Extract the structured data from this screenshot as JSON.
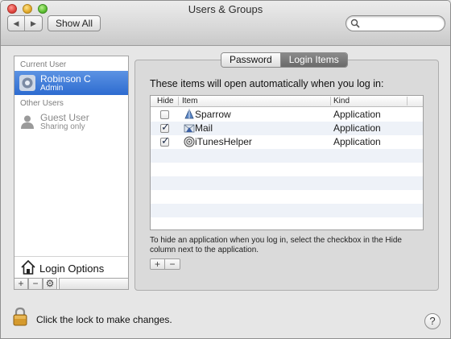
{
  "window": {
    "title": "Users & Groups"
  },
  "toolbar": {
    "back_icon": "◀",
    "forward_icon": "▶",
    "show_all_label": "Show All",
    "search_placeholder": ""
  },
  "sidebar": {
    "current_user_label": "Current User",
    "current_user": {
      "name": "Robinson C",
      "role": "Admin"
    },
    "other_users_label": "Other Users",
    "guest_user": {
      "name": "Guest User",
      "status": "Sharing only"
    },
    "login_options_label": "Login Options",
    "add_label": "+",
    "remove_label": "−",
    "gear_label": "⚙"
  },
  "tabs": [
    {
      "label": "Password",
      "active": false
    },
    {
      "label": "Login Items",
      "active": true
    }
  ],
  "login_items": {
    "intro": "These items will open automatically when you log in:",
    "columns": {
      "hide": "Hide",
      "item": "Item",
      "kind": "Kind"
    },
    "rows": [
      {
        "hide": false,
        "name": "Sparrow",
        "kind": "Application",
        "icon": "sparrow-icon"
      },
      {
        "hide": true,
        "name": "Mail",
        "kind": "Application",
        "icon": "mail-icon"
      },
      {
        "hide": true,
        "name": "iTunesHelper",
        "kind": "Application",
        "icon": "itunes-helper-icon"
      }
    ],
    "hint": "To hide an application when you log in, select the checkbox in the Hide column next to the application.",
    "add_label": "+",
    "remove_label": "−"
  },
  "footer": {
    "lock_text": "Click the lock to make changes.",
    "help_label": "?"
  },
  "colors": {
    "selection": "#2d6bd0",
    "row_alt": "#eef2f8"
  }
}
